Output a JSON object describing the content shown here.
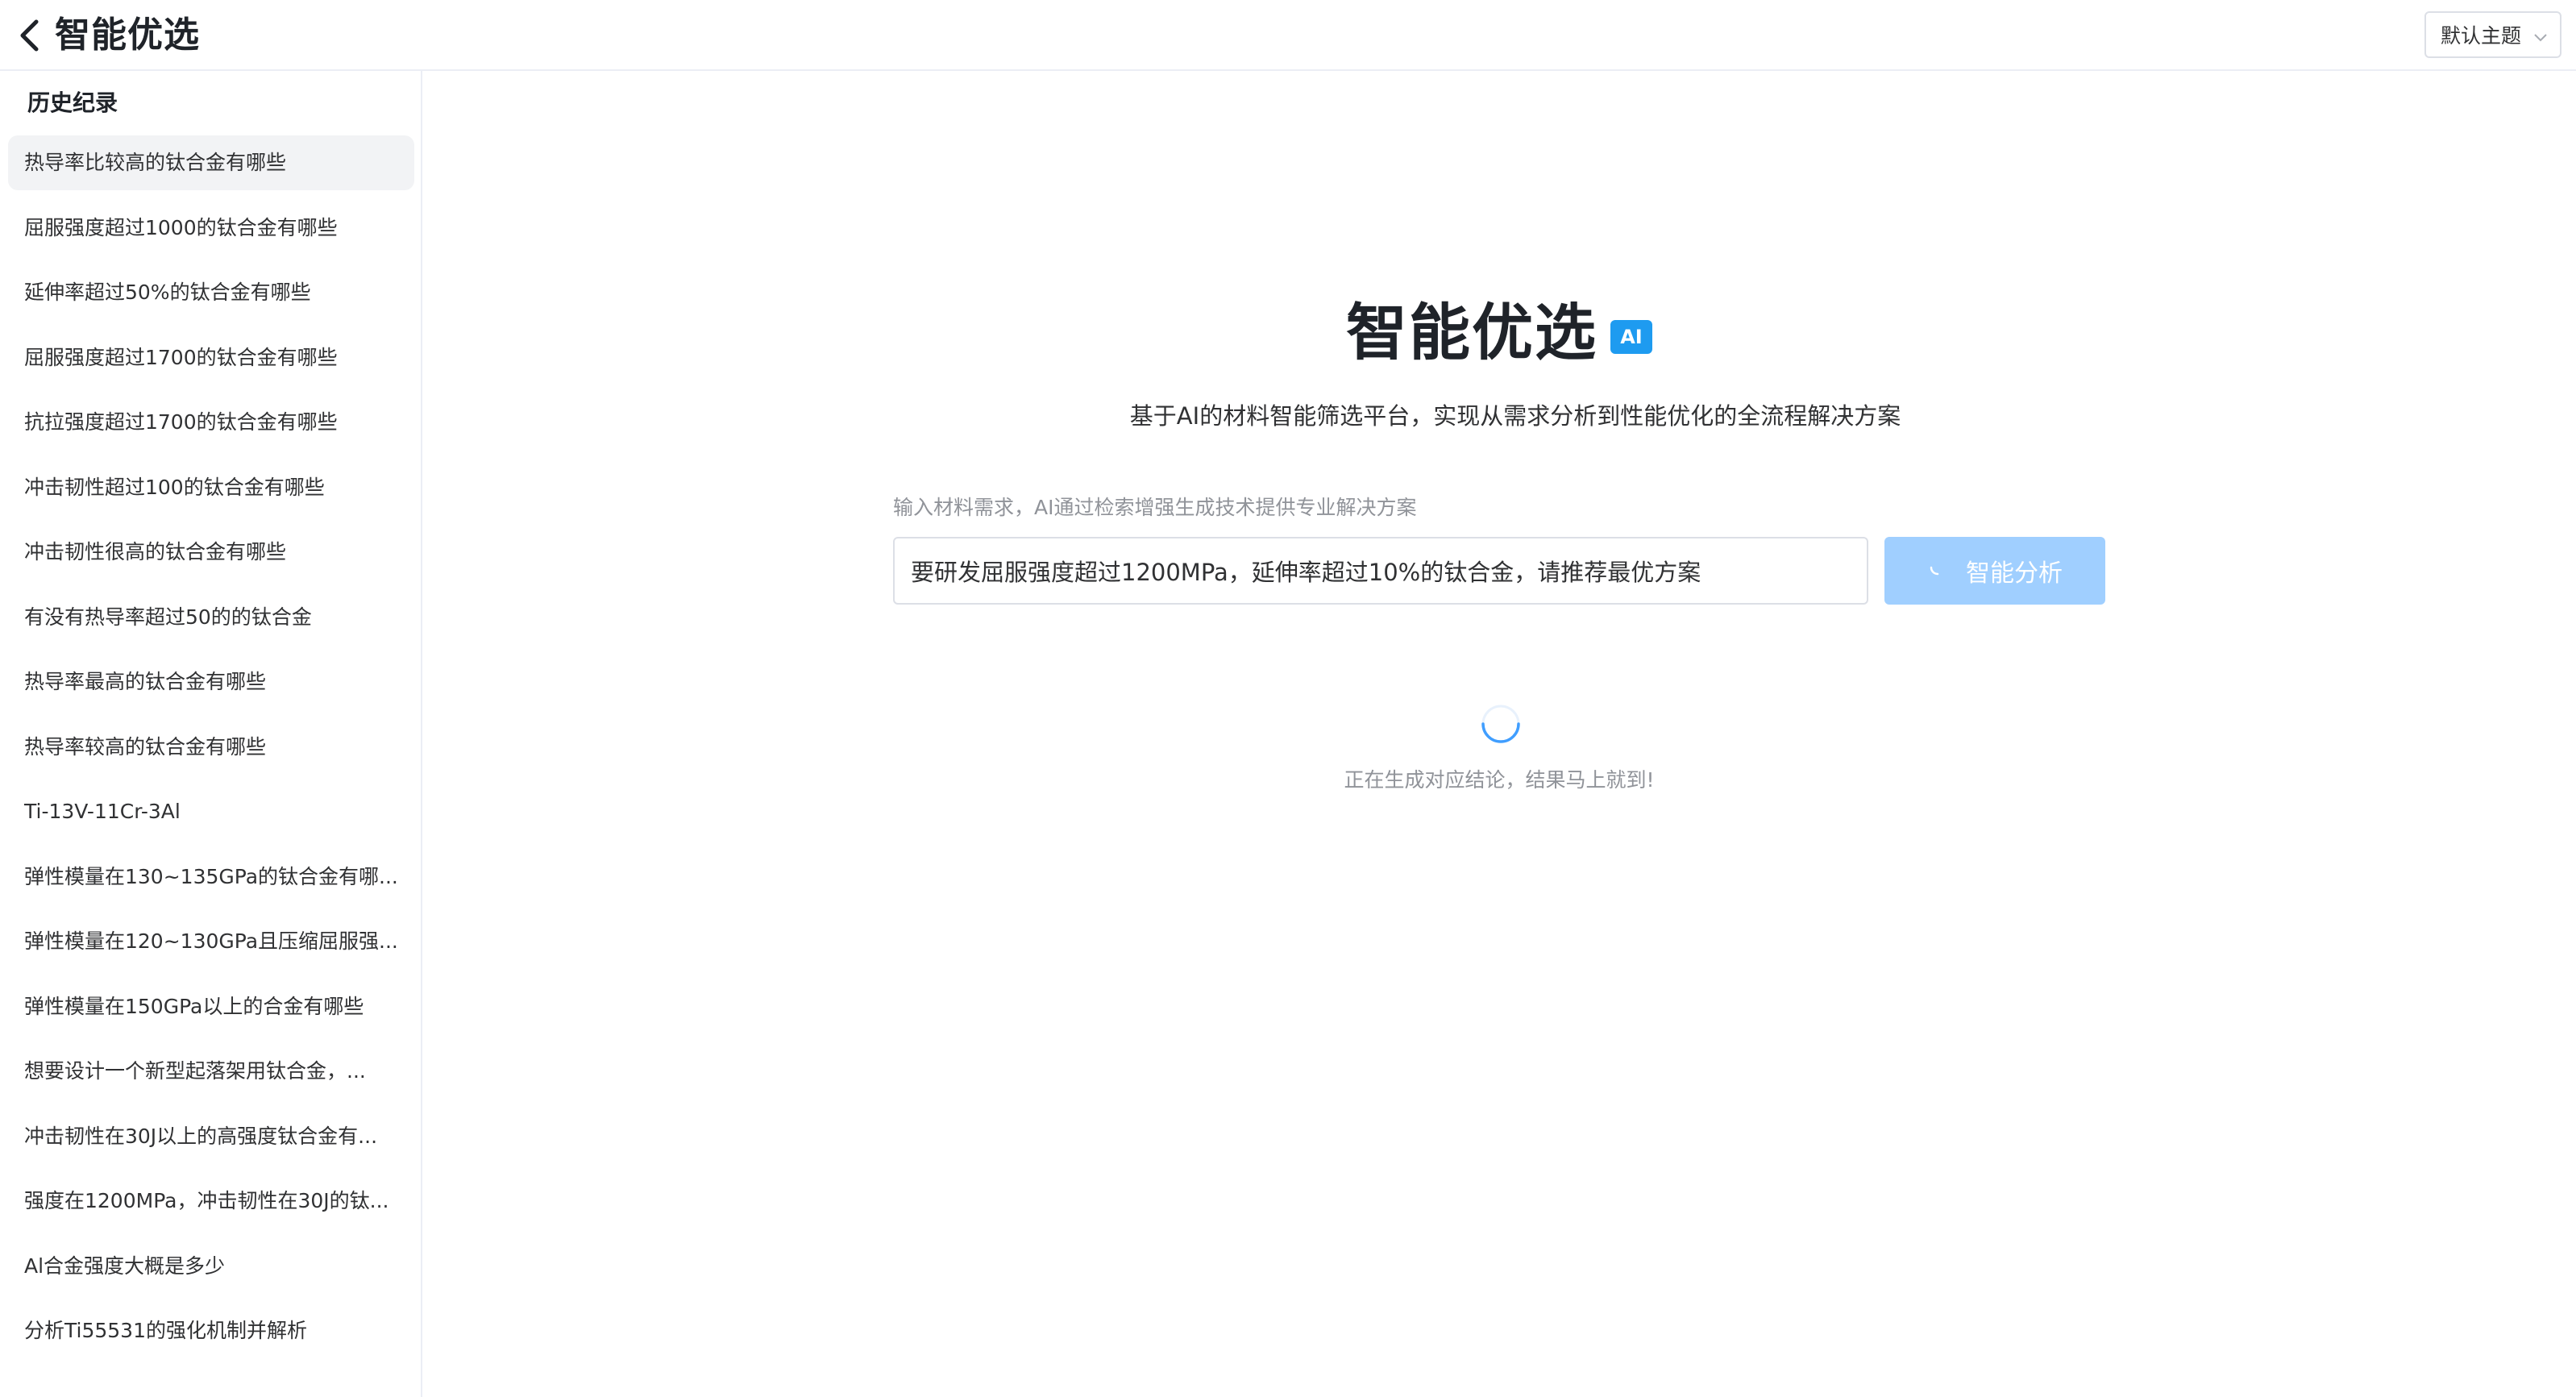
{
  "header": {
    "title": "智能优选",
    "back_icon": "chevron-left-icon",
    "theme_select": {
      "value": "默认主题",
      "icon": "chevron-down-icon"
    }
  },
  "sidebar": {
    "title": "历史纪录",
    "active_index": 0,
    "items": [
      {
        "label": "热导率比较高的钛合金有哪些"
      },
      {
        "label": "屈服强度超过1000的钛合金有哪些"
      },
      {
        "label": "延伸率超过50%的钛合金有哪些"
      },
      {
        "label": "屈服强度超过1700的钛合金有哪些"
      },
      {
        "label": "抗拉强度超过1700的钛合金有哪些"
      },
      {
        "label": "冲击韧性超过100的钛合金有哪些"
      },
      {
        "label": "冲击韧性很高的钛合金有哪些"
      },
      {
        "label": "有没有热导率超过50的的钛合金"
      },
      {
        "label": "热导率最高的钛合金有哪些"
      },
      {
        "label": "热导率较高的钛合金有哪些"
      },
      {
        "label": "Ti-13V-11Cr-3Al"
      },
      {
        "label": "弹性模量在130~135GPa的钛合金有哪..."
      },
      {
        "label": "弹性模量在120~130GPa且压缩屈服强..."
      },
      {
        "label": "弹性模量在150GPa以上的合金有哪些"
      },
      {
        "label": "想要设计一个新型起落架用钛合金，..."
      },
      {
        "label": "冲击韧性在30J以上的高强度钛合金有..."
      },
      {
        "label": "强度在1200MPa，冲击韧性在30J的钛..."
      },
      {
        "label": "Al合金强度大概是多少"
      },
      {
        "label": "分析Ti55531的强化机制并解析"
      }
    ]
  },
  "main": {
    "title": "智能优选",
    "badge": "AI",
    "subtitle": "基于AI的材料智能筛选平台，实现从需求分析到性能优化的全流程解决方案",
    "input_hint": "输入材料需求，AI通过检索增强生成技术提供专业解决方案",
    "input_value": "要研发屈服强度超过1200MPa，延伸率超过10%的钛合金，请推荐最优方案",
    "analyze_button": "智能分析",
    "loading_text": "正在生成对应结论，结果马上就到!",
    "accent_color": "#409eff",
    "button_disabled_color": "#a0cfff"
  }
}
